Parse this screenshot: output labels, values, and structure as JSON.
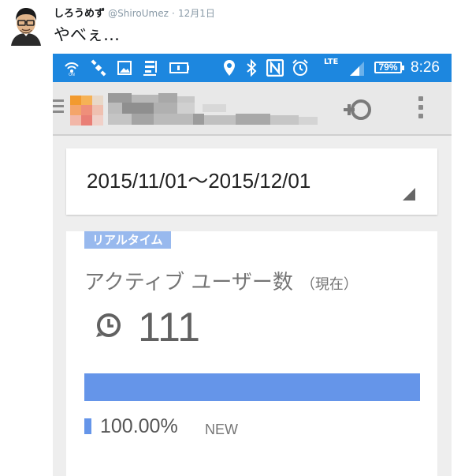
{
  "tweet": {
    "display_name": "しろうめず",
    "handle": "@ShiroUmez",
    "separator": "·",
    "date": "12月1日",
    "text": "やべぇ…"
  },
  "statusbar": {
    "network_type": "LTE",
    "battery": "79%",
    "time": "8:26",
    "icons": [
      "wifi-calling-icon",
      "satellite-icon",
      "image-icon",
      "notes-icon",
      "battery-saver-icon",
      "location-icon",
      "bluetooth-icon",
      "nfc-icon",
      "alarm-icon",
      "signal-icon"
    ]
  },
  "appbar": {
    "icons": [
      "menu-icon",
      "app-logo-icon",
      "add-segment-icon",
      "overflow-menu-icon"
    ]
  },
  "date_range": "2015/11/01〜2015/12/01",
  "realtime": {
    "badge": "リアルタイム",
    "label": "アクティブ ユーザー数",
    "label_sub": "（現在）",
    "count": "111",
    "legend_percent": "100.00%",
    "legend_label": "NEW",
    "new_fraction": 1.0,
    "bar_color": "#6595e9"
  },
  "colors": {
    "statusbar": "#1d87df",
    "badge": "#98b9ee",
    "bar": "#6595e9"
  }
}
